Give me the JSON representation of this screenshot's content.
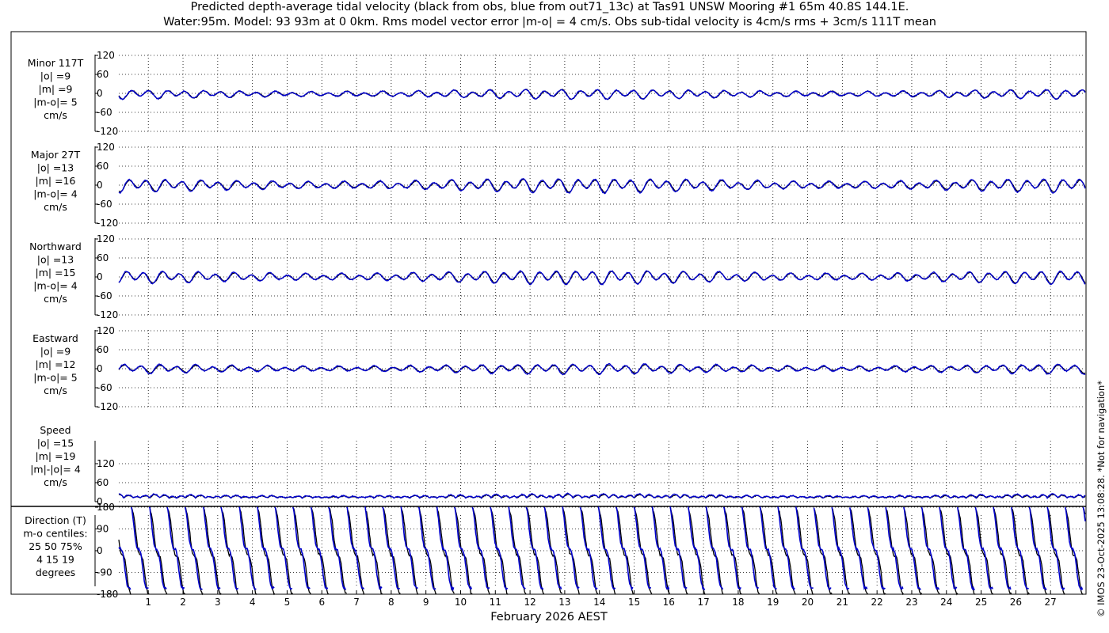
{
  "title_line1": "Predicted depth-average tidal velocity (black from obs, blue from out71_13c) at Tas91 UNSW Mooring #1 65m 40.8S 144.1E.",
  "title_line2": "Water:95m. Model: 93 93m at 0 0km. Rms model vector error |m-o| = 4 cm/s. Obs sub-tidal velocity is 4cm/s rms + 3cm/s 111T mean",
  "copyright": "© IMOS 23-Oct-2025 13:08:28. *Not for navigation*",
  "colors": {
    "obs": "#000000",
    "model": "#0000cc",
    "grid": "#000000"
  },
  "chart_data": {
    "type": "line",
    "xlabel": "February 2026 AEST",
    "x_ticks": [
      "1",
      "2",
      "3",
      "4",
      "5",
      "6",
      "7",
      "8",
      "9",
      "10",
      "11",
      "12",
      "13",
      "14",
      "15",
      "16",
      "17",
      "18",
      "19",
      "20",
      "21",
      "22",
      "23",
      "24",
      "25",
      "26",
      "27"
    ],
    "x_range_days": [
      0.15,
      28.0
    ],
    "grid": true,
    "series_legend": [
      {
        "name": "black from obs",
        "color": "#000000"
      },
      {
        "name": "blue from out71_13c",
        "color": "#0000cc"
      }
    ],
    "panels": [
      {
        "key": "minor",
        "label_lines": [
          "Minor 117T",
          "|o| =9",
          "|m| =9",
          "|m-o|= 5",
          "cm/s"
        ],
        "yticks": [
          "120",
          "60",
          "0",
          "-60",
          "-120"
        ],
        "ylim": [
          -120,
          120
        ],
        "obs_amplitude": 14,
        "model_amplitude": 14,
        "mean": -2
      },
      {
        "key": "major",
        "label_lines": [
          "Major 27T",
          "|o| =13",
          "|m| =16",
          "|m-o|= 4",
          "cm/s"
        ],
        "yticks": [
          "120",
          "60",
          "0",
          "-60",
          "-120"
        ],
        "ylim": [
          -120,
          120
        ],
        "obs_amplitude": 18,
        "model_amplitude": 21,
        "mean": 0
      },
      {
        "key": "north",
        "label_lines": [
          "Northward",
          "|o| =13",
          "|m| =15",
          "|m-o|= 4",
          "cm/s"
        ],
        "yticks": [
          "120",
          "60",
          "0",
          "-60",
          "-120"
        ],
        "ylim": [
          -120,
          120
        ],
        "obs_amplitude": 18,
        "model_amplitude": 20,
        "mean": 0
      },
      {
        "key": "east",
        "label_lines": [
          "Eastward",
          "|o| =9",
          "|m| =12",
          "|m-o|= 5",
          "cm/s"
        ],
        "yticks": [
          "120",
          "60",
          "0",
          "-60",
          "-120"
        ],
        "ylim": [
          -120,
          120
        ],
        "obs_amplitude": 12,
        "model_amplitude": 15,
        "mean": 0
      },
      {
        "key": "speed",
        "label_lines": [
          "Speed",
          "|o| =15",
          "|m| =19",
          "|m|-|o|= 4",
          "cm/s"
        ],
        "yticks": [
          "120",
          "60",
          "0"
        ],
        "ylim": [
          0,
          120
        ],
        "obs_amplitude": 15,
        "model_amplitude": 19,
        "mean": 15
      },
      {
        "key": "direction",
        "label_lines": [
          "Direction (T)",
          "m-o centiles:",
          "25  50  75%",
          "4  15  19",
          "degrees"
        ],
        "yticks": [
          "180",
          "90",
          "0",
          "-90",
          "-180"
        ],
        "ylim": [
          -180,
          180
        ],
        "centiles_25_50_75": [
          4,
          15,
          19
        ]
      }
    ]
  }
}
